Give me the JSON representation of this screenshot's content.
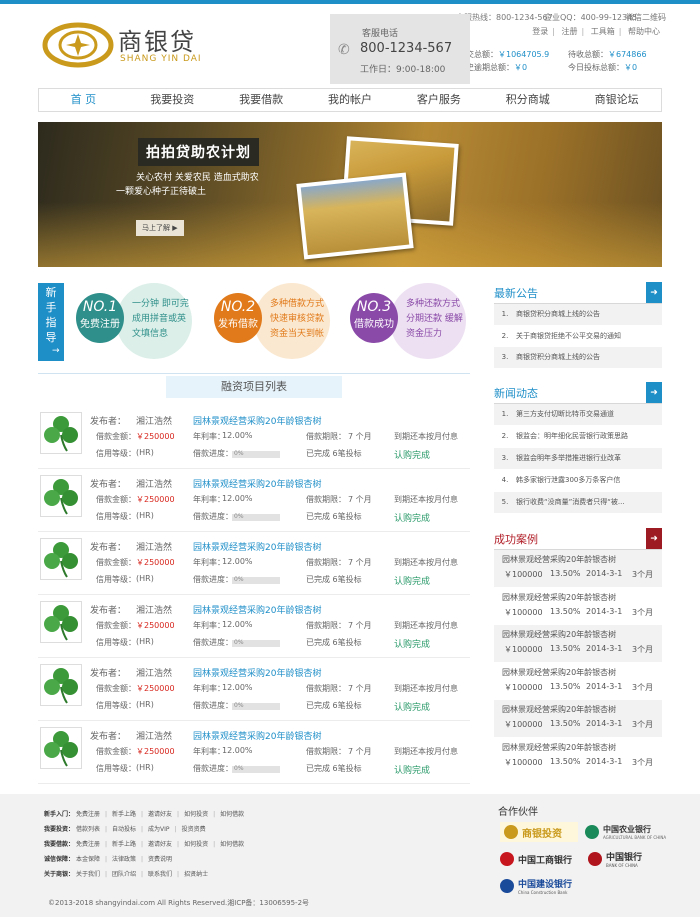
{
  "header": {
    "logo_cn": "商银贷",
    "logo_en": "SHANG YIN DAI",
    "hotline": "客服热线：800-1234-567",
    "qq": "企业QQ：400-99-12345",
    "wechat": "微信二维码",
    "links": [
      "登录",
      "注册",
      "工具箱",
      "帮助中心"
    ],
    "stats": {
      "total_label": "成交总额：",
      "total_value": "￥1064705.9",
      "pending_label": "待收总额：",
      "pending_value": "￥674866",
      "overdue_label": "历史逾期总额：",
      "overdue_value": "￥0",
      "today_label": "今日投标总额：",
      "today_value": "￥0"
    }
  },
  "nav": [
    "首 页",
    "我要投资",
    "我要借款",
    "我的帐户",
    "客户服务",
    "积分商城",
    "商银论坛"
  ],
  "banner": {
    "title": "拍拍贷助农计划",
    "line1": "关心农村 关爱农民 造血式助农",
    "line2": "一颗爱心种子正待破土",
    "button": "马上了解"
  },
  "guide": {
    "tab_label": "新手指导",
    "arrow": "→",
    "steps": [
      {
        "no": "NO.1",
        "title": "免费注册",
        "desc": "一分钟 即可完成用拼音或英文填信息",
        "color": "#2f8f8a",
        "bg": "#dcefe9"
      },
      {
        "no": "NO.2",
        "title": "发布借款",
        "desc": "多种借款方式快速审核贷款 资金当天到帐",
        "color": "#e07a1a",
        "bg": "#fbe8d0"
      },
      {
        "no": "NO.3",
        "title": "借款成功",
        "desc": "多种还款方式分期还款 缓解资金压力",
        "color": "#8a4aa8",
        "bg": "#ede0f2"
      }
    ]
  },
  "loans_section_title": "融资项目列表",
  "loan_labels": {
    "publisher": "发布者：",
    "amount": "借款金额：",
    "rate": "年利率：",
    "term": "借款期限：",
    "repay": "到期还本按月付息",
    "credit": "信用等级：",
    "progress": "借款进度：",
    "done": "已完成 6笔投标",
    "status": "认购完成"
  },
  "loans": [
    {
      "publisher": "湘江浩然",
      "title": "园林景观经营采购20年龄银杏树",
      "amount": "￥250000",
      "rate": "12.00%",
      "term": "7 个月",
      "credit": "(HR)",
      "progress": "0%"
    },
    {
      "publisher": "湘江浩然",
      "title": "园林景观经营采购20年龄银杏树",
      "amount": "￥250000",
      "rate": "12.00%",
      "term": "7 个月",
      "credit": "(HR)",
      "progress": "0%"
    },
    {
      "publisher": "湘江浩然",
      "title": "园林景观经营采购20年龄银杏树",
      "amount": "￥250000",
      "rate": "12.00%",
      "term": "7 个月",
      "credit": "(HR)",
      "progress": "0%"
    },
    {
      "publisher": "湘江浩然",
      "title": "园林景观经营采购20年龄银杏树",
      "amount": "￥250000",
      "rate": "12.00%",
      "term": "7 个月",
      "credit": "(HR)",
      "progress": "0%"
    },
    {
      "publisher": "湘江浩然",
      "title": "园林景观经营采购20年龄银杏树",
      "amount": "￥250000",
      "rate": "12.00%",
      "term": "7 个月",
      "credit": "(HR)",
      "progress": "0%"
    },
    {
      "publisher": "湘江浩然",
      "title": "园林景观经营采购20年龄银杏树",
      "amount": "￥250000",
      "rate": "12.00%",
      "term": "7 个月",
      "credit": "(HR)",
      "progress": "0%"
    }
  ],
  "sidebar": {
    "notices_title": "最新公告",
    "notices": [
      "商银贷积分商城上线的公告",
      "关于商银贷拒绝不公平交易的通知",
      "商银贷积分商城上线的公告"
    ],
    "news_title": "新闻动态",
    "news": [
      "第三方支付切断比特币交易通道",
      "银监会：明年细化民营银行政策思路",
      "银监会明年多举措推进银行业改革",
      "韩多家银行泄露300多万条客户信",
      "银行收费“没商量”消费者只得“被..."
    ],
    "cases_title": "成功案例",
    "cases": [
      {
        "title": "园林景观经营采购20年龄银杏树",
        "amount": "￥100000",
        "rate": "13.50%",
        "date": "2014-3-1",
        "term": "3个月"
      },
      {
        "title": "园林景观经营采购20年龄银杏树",
        "amount": "￥100000",
        "rate": "13.50%",
        "date": "2014-3-1",
        "term": "3个月"
      },
      {
        "title": "园林景观经营采购20年龄银杏树",
        "amount": "￥100000",
        "rate": "13.50%",
        "date": "2014-3-1",
        "term": "3个月"
      },
      {
        "title": "园林景观经营采购20年龄银杏树",
        "amount": "￥100000",
        "rate": "13.50%",
        "date": "2014-3-1",
        "term": "3个月"
      },
      {
        "title": "园林景观经营采购20年龄银杏树",
        "amount": "￥100000",
        "rate": "13.50%",
        "date": "2014-3-1",
        "term": "3个月"
      },
      {
        "title": "园林景观经营采购20年龄银杏树",
        "amount": "￥100000",
        "rate": "13.50%",
        "date": "2014-3-1",
        "term": "3个月"
      }
    ]
  },
  "footer": {
    "rows": [
      {
        "label": "新手入门：",
        "links": [
          "免费注册",
          "新手上路",
          "邀请好友",
          "如何投资",
          "如何借款"
        ]
      },
      {
        "label": "我要投资：",
        "links": [
          "借款列表",
          "自动投标",
          "成为VIP",
          "投资资费"
        ]
      },
      {
        "label": "我要借款：",
        "links": [
          "免费注册",
          "新手上路",
          "邀请好友",
          "如何投资",
          "如何借款"
        ]
      },
      {
        "label": "诚信保障：",
        "links": [
          "本金保障",
          "法律政策",
          "资费说明"
        ]
      },
      {
        "label": "关于商银：",
        "links": [
          "关于我们",
          "团队介绍",
          "联系我们",
          "招贤纳士"
        ]
      }
    ],
    "hotline_label": "客服电话",
    "hotline_number": "800-1234-567",
    "hotline_time": "工作日：9:00-18:00",
    "partners_title": "合作伙伴",
    "partners": [
      "商银投资",
      "中国农业银行",
      "中国工商银行",
      "中国银行",
      "中国建设银行"
    ],
    "partners_en": [
      "",
      "AGRICULTURAL BANK OF CHINA",
      "",
      "BANK OF CHINA",
      "China Construction Bank"
    ],
    "copyright": "©2013-2018 shangyindai.com All Rights Reserved.湘ICP备：13006595-2号"
  },
  "colors": {
    "accent": "#1f8fc8",
    "red": "#d7261e",
    "case": "#b2202a"
  }
}
